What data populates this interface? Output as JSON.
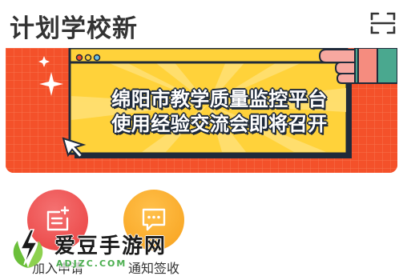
{
  "header": {
    "title": "计划学校新",
    "scan_icon": "scan-icon"
  },
  "banner": {
    "line1": "绵阳市教学质量监控平台",
    "line2": "使用经验交流会即将召开",
    "colors": {
      "background": "#f4512a",
      "panel": "#ffd23a",
      "panel_border": "#1f2a3a"
    }
  },
  "actions": [
    {
      "label": "加入申请",
      "icon": "join-request-icon",
      "color": "#ea3f3f"
    },
    {
      "label": "通知签收",
      "icon": "message-icon",
      "color": "#f7a11d"
    }
  ],
  "watermark": {
    "text": "爱豆手游网",
    "sub": "ADJZC.COM",
    "logo": "lightning-leaf-logo"
  }
}
